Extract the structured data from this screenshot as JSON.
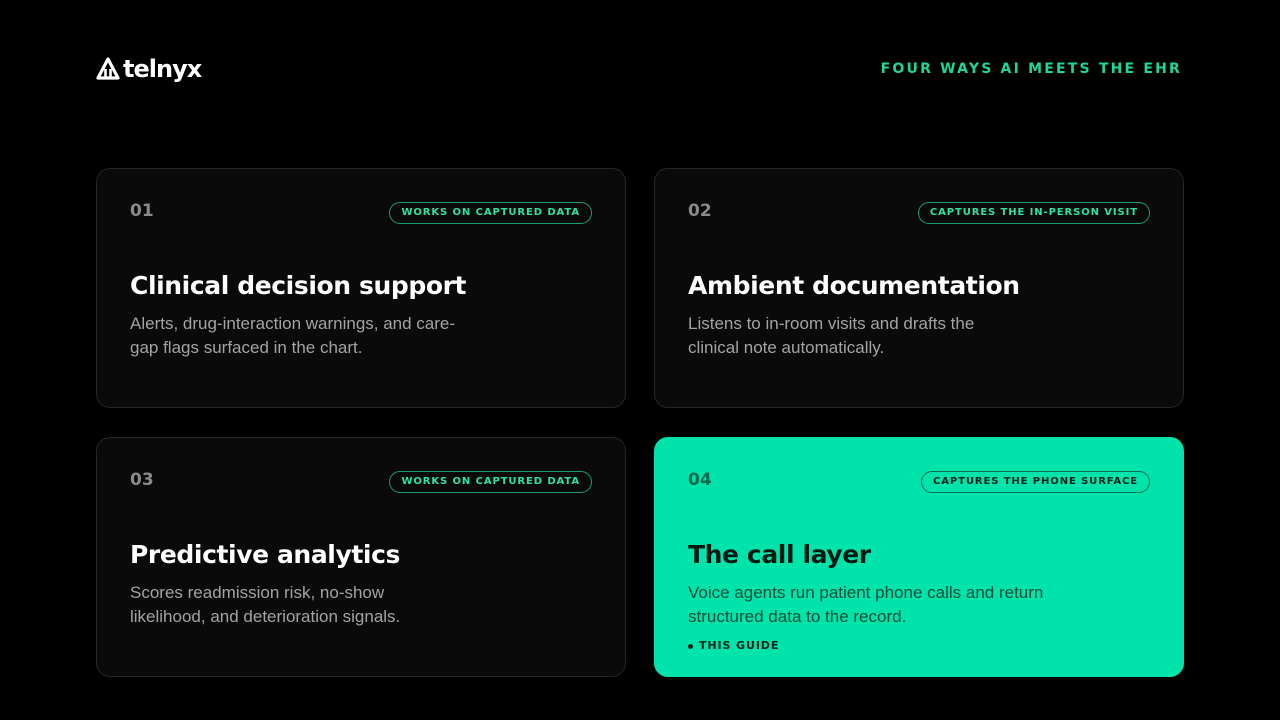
{
  "brand": {
    "logo_text": "telnyx",
    "logo_icon": "telnyx-mark-icon"
  },
  "header": {
    "tagline": "FOUR WAYS AI MEETS THE EHR"
  },
  "colors": {
    "background": "#000000",
    "accent": "#00e3aa",
    "accent_text": "#1fd69a",
    "card_background": "#0a0a0a",
    "card_border": "#262626"
  },
  "cards": [
    {
      "number": "01",
      "badge": "WORKS ON CAPTURED DATA",
      "title": "Clinical decision support",
      "description": "Alerts, drug-interaction warnings, and care-gap flags surfaced in the chart."
    },
    {
      "number": "02",
      "badge": "CAPTURES THE IN-PERSON VISIT",
      "title": "Ambient documentation",
      "description": "Listens to in-room visits and drafts the clinical note automatically."
    },
    {
      "number": "03",
      "badge": "WORKS ON CAPTURED DATA",
      "title": "Predictive analytics",
      "description": "Scores readmission risk, no-show likelihood, and deterioration signals."
    },
    {
      "number": "04",
      "badge": "CAPTURES THE PHONE SURFACE",
      "title": "The call layer",
      "description": "Voice agents run patient phone calls and return structured data to the record.",
      "highlight_label": "THIS GUIDE"
    }
  ]
}
